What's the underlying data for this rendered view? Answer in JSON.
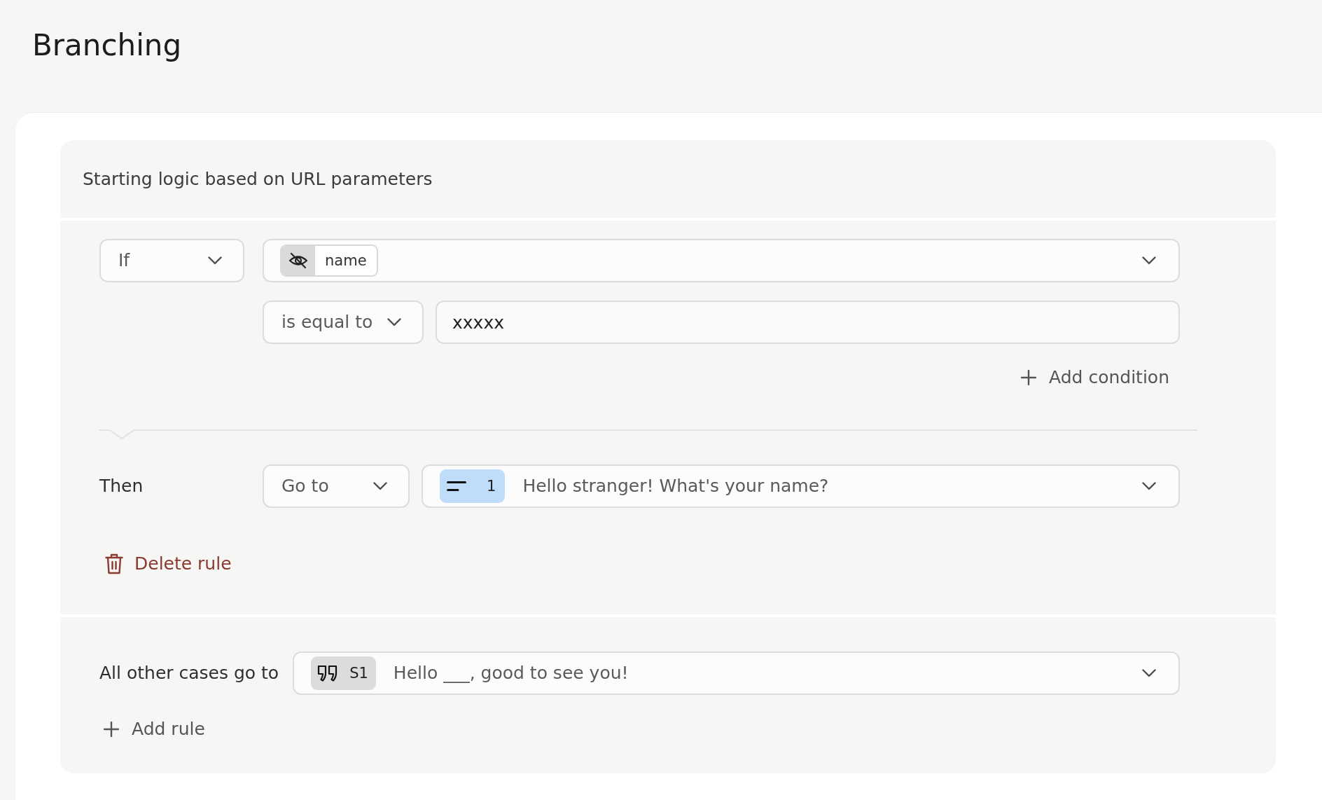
{
  "page": {
    "title": "Branching"
  },
  "logic": {
    "title": "Starting logic based on URL parameters",
    "rules": [
      {
        "conditions": [
          {
            "connector": "If",
            "field": {
              "kind": "hidden",
              "name": "name"
            },
            "operator": "is equal to",
            "value": "xxxxx"
          }
        ],
        "add_condition": "Add condition",
        "then_label": "Then",
        "action": "Go to",
        "target": {
          "kind": "question",
          "number": "1",
          "text": "Hello stranger! What's your name?"
        },
        "delete_label": "Delete rule"
      }
    ],
    "fallback": {
      "label": "All other cases go to",
      "target": {
        "kind": "statement",
        "number": "S1",
        "text": "Hello ___, good to see you!"
      }
    },
    "add_rule": "Add rule"
  }
}
